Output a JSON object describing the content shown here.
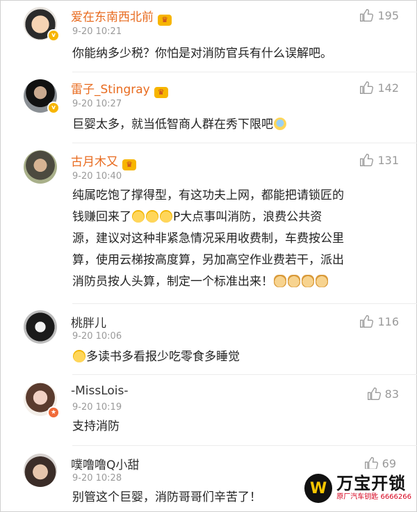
{
  "comments": [
    {
      "username": "爱在东南西北前",
      "time": "9-20 10:21",
      "likes": "195",
      "text": "你能纳多少税？你怕是对消防官兵有什么误解吧。"
    },
    {
      "username": "雷子_Stingray",
      "time": "9-20 10:27",
      "likes": "142",
      "text": "巨婴太多，就当低智商人群在秀下限吧"
    },
    {
      "username": "古月木又",
      "time": "9-20 10:40",
      "likes": "131",
      "text_lines": [
        "纯属吃饱了撑得型，有这功夫上网，都能把请锁匠的",
        "钱赚回来了",
        "P大点事叫消防，浪费公共资",
        "源，建议对这种非紧急情况采用收费制，车费按公里",
        "算，使用云梯按高度算，另加高空作业费若干，派出",
        "消防员按人头算，制定一个标准出来！"
      ]
    },
    {
      "username": "桃胖儿",
      "time": "9-20 10:06",
      "likes": "116",
      "text": "多读书多看报少吃零食多睡觉"
    },
    {
      "username": "-MissLois-",
      "time": "9-20 10:19",
      "likes": "83",
      "text": "支持消防"
    },
    {
      "username": "噗噜噜Q小甜",
      "time": "9-20 10:28",
      "likes": "69",
      "text": "别管这个巨婴，消防哥哥们辛苦了！"
    }
  ],
  "watermark": {
    "title": "万宝开锁",
    "subtitle": "原厂汽车钥匙 6666266"
  },
  "colors": {
    "vip_name": "#e86b1f",
    "normal_name": "#333333",
    "meta": "#9a9a9a",
    "body_text": "#222222"
  }
}
